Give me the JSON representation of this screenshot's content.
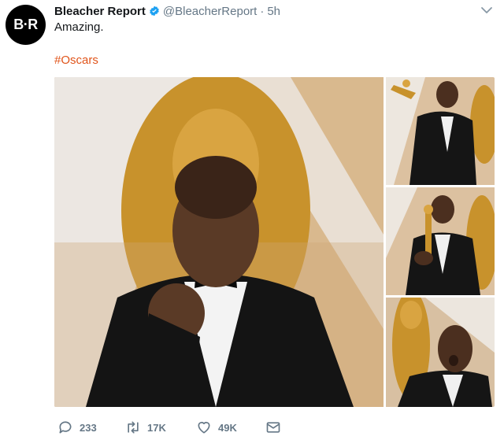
{
  "tweet": {
    "avatar_text": "B·R",
    "author_name": "Bleacher Report",
    "handle": "@BleacherReport",
    "separator": "·",
    "time": "5h",
    "text": "Amazing.",
    "hashtag": "#Oscars"
  },
  "actions": {
    "replies": "233",
    "retweets": "17K",
    "likes": "49K"
  },
  "colors": {
    "hashtag": "#e0541a",
    "verified": "#1da1f2",
    "muted": "#657786"
  }
}
